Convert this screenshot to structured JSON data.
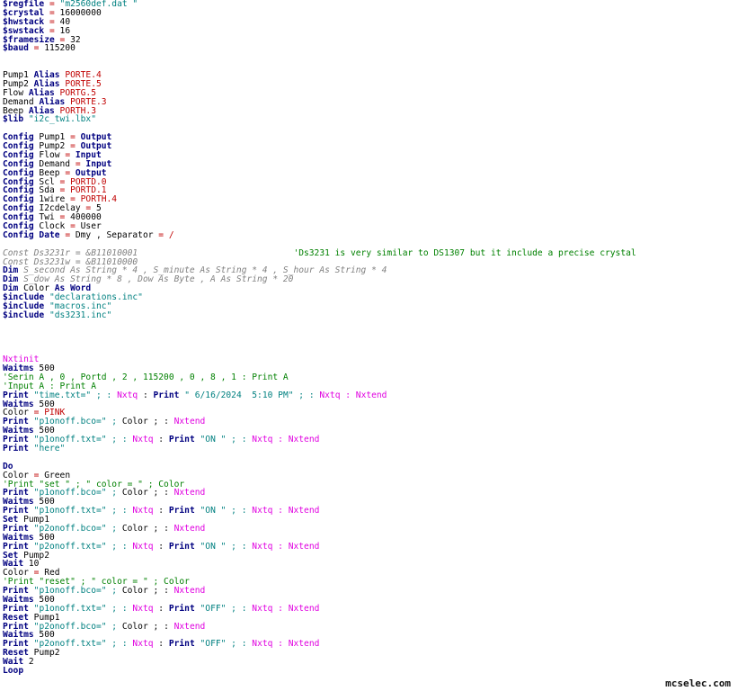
{
  "editor": {
    "lines": [
      {
        "row": 0,
        "t": [
          [
            "kw",
            "$regfile"
          ],
          [
            "red",
            " = "
          ],
          [
            "str",
            "\"m2560def.dat \""
          ]
        ]
      },
      {
        "row": 1,
        "t": [
          [
            "kw",
            "$crystal"
          ],
          [
            "red",
            " = "
          ],
          [
            "pl",
            "16000000"
          ]
        ]
      },
      {
        "row": 2,
        "t": [
          [
            "kw",
            "$hwstack"
          ],
          [
            "red",
            " = "
          ],
          [
            "pl",
            "40"
          ]
        ]
      },
      {
        "row": 3,
        "t": [
          [
            "kw",
            "$swstack"
          ],
          [
            "red",
            " = "
          ],
          [
            "pl",
            "16"
          ]
        ]
      },
      {
        "row": 4,
        "t": [
          [
            "kw",
            "$framesize"
          ],
          [
            "red",
            " = "
          ],
          [
            "pl",
            "32"
          ]
        ]
      },
      {
        "row": 5,
        "t": [
          [
            "kw",
            "$baud"
          ],
          [
            "red",
            " = "
          ],
          [
            "pl",
            "115200"
          ]
        ]
      },
      {
        "row": 8,
        "t": [
          [
            "pl",
            "Pump1 "
          ],
          [
            "kw",
            "Alias"
          ],
          [
            "red",
            " PORTE.4"
          ]
        ]
      },
      {
        "row": 9,
        "t": [
          [
            "pl",
            "Pump2 "
          ],
          [
            "kw",
            "Alias"
          ],
          [
            "red",
            " PORTE.5"
          ]
        ]
      },
      {
        "row": 10,
        "t": [
          [
            "pl",
            "Flow "
          ],
          [
            "kw",
            "Alias"
          ],
          [
            "red",
            " PORTG.5"
          ]
        ]
      },
      {
        "row": 11,
        "t": [
          [
            "pl",
            "Demand "
          ],
          [
            "kw",
            "Alias"
          ],
          [
            "red",
            " PORTE.3"
          ]
        ]
      },
      {
        "row": 12,
        "t": [
          [
            "pl",
            "Beep "
          ],
          [
            "kw",
            "Alias"
          ],
          [
            "red",
            " PORTH.3"
          ]
        ]
      },
      {
        "row": 13,
        "t": [
          [
            "kw",
            "$lib"
          ],
          [
            "str",
            " \"i2c_twi.lbx\""
          ]
        ]
      },
      {
        "row": 15,
        "t": [
          [
            "kw",
            "Config"
          ],
          [
            "pl",
            " Pump1 "
          ],
          [
            "red",
            "="
          ],
          [
            "kw",
            " Output"
          ]
        ]
      },
      {
        "row": 16,
        "t": [
          [
            "kw",
            "Config"
          ],
          [
            "pl",
            " Pump2 "
          ],
          [
            "red",
            "="
          ],
          [
            "kw",
            " Output"
          ]
        ]
      },
      {
        "row": 17,
        "t": [
          [
            "kw",
            "Config"
          ],
          [
            "pl",
            " Flow "
          ],
          [
            "red",
            "="
          ],
          [
            "kw",
            " Input"
          ]
        ]
      },
      {
        "row": 18,
        "t": [
          [
            "kw",
            "Config"
          ],
          [
            "pl",
            " Demand "
          ],
          [
            "red",
            "="
          ],
          [
            "kw",
            " Input"
          ]
        ]
      },
      {
        "row": 19,
        "t": [
          [
            "kw",
            "Config"
          ],
          [
            "pl",
            " Beep "
          ],
          [
            "red",
            "="
          ],
          [
            "kw",
            " Output"
          ]
        ]
      },
      {
        "row": 20,
        "t": [
          [
            "kw",
            "Config"
          ],
          [
            "pl",
            " Scl "
          ],
          [
            "red",
            "= PORTD.0"
          ]
        ]
      },
      {
        "row": 21,
        "t": [
          [
            "kw",
            "Config"
          ],
          [
            "pl",
            " Sda "
          ],
          [
            "red",
            "= PORTD.1"
          ]
        ]
      },
      {
        "row": 22,
        "t": [
          [
            "kw",
            "Config"
          ],
          [
            "pl",
            " 1wire "
          ],
          [
            "red",
            "= PORTH.4"
          ]
        ]
      },
      {
        "row": 23,
        "t": [
          [
            "kw",
            "Config"
          ],
          [
            "pl",
            " I2cdelay "
          ],
          [
            "red",
            "="
          ],
          [
            "pl",
            " 5"
          ]
        ]
      },
      {
        "row": 24,
        "t": [
          [
            "kw",
            "Config"
          ],
          [
            "pl",
            " Twi "
          ],
          [
            "red",
            "="
          ],
          [
            "pl",
            " 400000"
          ]
        ]
      },
      {
        "row": 25,
        "t": [
          [
            "kw",
            "Config"
          ],
          [
            "pl",
            " Clock "
          ],
          [
            "red",
            "="
          ],
          [
            "pl",
            " User"
          ]
        ]
      },
      {
        "row": 26,
        "t": [
          [
            "kw",
            "Config Date"
          ],
          [
            "red",
            " = "
          ],
          [
            "pl",
            "Dmy , Separator "
          ],
          [
            "red",
            "= /"
          ]
        ]
      },
      {
        "row": 28,
        "t": [
          [
            "ita",
            "Const Ds3231r = &B11010001                              "
          ],
          [
            "cmt",
            "'Ds3231 is very similar to DS1307 but it include a precise crystal"
          ]
        ]
      },
      {
        "row": 29,
        "t": [
          [
            "ita",
            "Const Ds3231w = &B11010000"
          ]
        ]
      },
      {
        "row": 30,
        "t": [
          [
            "kw",
            "Dim"
          ],
          [
            "ita",
            " S_second As String * 4 , S_minute As String * 4 , S_hour As String * 4"
          ]
        ]
      },
      {
        "row": 31,
        "t": [
          [
            "kw",
            "Dim"
          ],
          [
            "ita",
            " S_dow As String * 8 , Dow As Byte , A As String * 20"
          ]
        ]
      },
      {
        "row": 32,
        "t": [
          [
            "kw",
            "Dim"
          ],
          [
            "pl",
            " Color "
          ],
          [
            "kw",
            "As Word"
          ]
        ]
      },
      {
        "row": 33,
        "t": [
          [
            "kw",
            "$include"
          ],
          [
            "str",
            " \"declarations.inc\""
          ]
        ]
      },
      {
        "row": 34,
        "t": [
          [
            "kw",
            "$include"
          ],
          [
            "str",
            " \"macros.inc\""
          ]
        ]
      },
      {
        "row": 35,
        "t": [
          [
            "kw",
            "$include"
          ],
          [
            "str",
            " \"ds3231.inc\""
          ]
        ]
      },
      {
        "row": 40,
        "t": [
          [
            "mag",
            "Nxtinit"
          ]
        ]
      },
      {
        "row": 41,
        "t": [
          [
            "kw",
            "Waitms"
          ],
          [
            "pl",
            " 500"
          ]
        ]
      },
      {
        "row": 42,
        "t": [
          [
            "cmt",
            "'Serin A , 0 , Portd , 2 , 115200 , 0 , 8 , 1 : Print A"
          ]
        ]
      },
      {
        "row": 43,
        "t": [
          [
            "cmt",
            "'Input A : Print A"
          ]
        ]
      },
      {
        "row": 44,
        "t": [
          [
            "kw",
            "Print"
          ],
          [
            "str",
            " \"time.txt=\" ; : "
          ],
          [
            "mag",
            "Nxtq"
          ],
          [
            "pl",
            " : "
          ],
          [
            "kw",
            "Print"
          ],
          [
            "str",
            " \" 6/16/2024  5:10 PM\" ; : "
          ],
          [
            "mag",
            "Nxtq : Nxtend"
          ]
        ]
      },
      {
        "row": 45,
        "t": [
          [
            "kw",
            "Waitms"
          ],
          [
            "pl",
            " 500"
          ]
        ]
      },
      {
        "row": 46,
        "t": [
          [
            "pl",
            "Color "
          ],
          [
            "red",
            "= PINK"
          ]
        ]
      },
      {
        "row": 47,
        "t": [
          [
            "kw",
            "Print"
          ],
          [
            "str",
            " \"p1onoff.bco=\" ; "
          ],
          [
            "pl",
            "Color ; : "
          ],
          [
            "mag",
            "Nxtend"
          ]
        ]
      },
      {
        "row": 48,
        "t": [
          [
            "kw",
            "Waitms"
          ],
          [
            "pl",
            " 500"
          ]
        ]
      },
      {
        "row": 49,
        "t": [
          [
            "kw",
            "Print"
          ],
          [
            "str",
            " \"p1onoff.txt=\" ; : "
          ],
          [
            "mag",
            "Nxtq"
          ],
          [
            "pl",
            " : "
          ],
          [
            "kw",
            "Print"
          ],
          [
            "str",
            " \"ON \" ; : "
          ],
          [
            "mag",
            "Nxtq : Nxtend"
          ]
        ]
      },
      {
        "row": 50,
        "t": [
          [
            "kw",
            "Print"
          ],
          [
            "str",
            " \"here\""
          ]
        ]
      },
      {
        "row": 52,
        "t": [
          [
            "kw",
            "Do"
          ]
        ]
      },
      {
        "row": 53,
        "t": [
          [
            "pl",
            "Color "
          ],
          [
            "red",
            "="
          ],
          [
            "pl",
            " Green"
          ]
        ]
      },
      {
        "row": 54,
        "t": [
          [
            "cmt",
            "'Print \"set \" ; \" color = \" ; Color"
          ]
        ]
      },
      {
        "row": 55,
        "t": [
          [
            "kw",
            "Print"
          ],
          [
            "str",
            " \"p1onoff.bco=\" ; "
          ],
          [
            "pl",
            "Color ; : "
          ],
          [
            "mag",
            "Nxtend"
          ]
        ]
      },
      {
        "row": 56,
        "t": [
          [
            "kw",
            "Waitms"
          ],
          [
            "pl",
            " 500"
          ]
        ]
      },
      {
        "row": 57,
        "t": [
          [
            "kw",
            "Print"
          ],
          [
            "str",
            " \"p1onoff.txt=\" ; : "
          ],
          [
            "mag",
            "Nxtq"
          ],
          [
            "pl",
            " : "
          ],
          [
            "kw",
            "Print"
          ],
          [
            "str",
            " \"ON \" ; : "
          ],
          [
            "mag",
            "Nxtq : Nxtend"
          ]
        ]
      },
      {
        "row": 58,
        "t": [
          [
            "kw",
            "Set"
          ],
          [
            "pl",
            " Pump1"
          ]
        ]
      },
      {
        "row": 59,
        "t": [
          [
            "kw",
            "Print"
          ],
          [
            "str",
            " \"p2onoff.bco=\" ; "
          ],
          [
            "pl",
            "Color ; : "
          ],
          [
            "mag",
            "Nxtend"
          ]
        ]
      },
      {
        "row": 60,
        "t": [
          [
            "kw",
            "Waitms"
          ],
          [
            "pl",
            " 500"
          ]
        ]
      },
      {
        "row": 61,
        "t": [
          [
            "kw",
            "Print"
          ],
          [
            "str",
            " \"p2onoff.txt=\" ; : "
          ],
          [
            "mag",
            "Nxtq"
          ],
          [
            "pl",
            " : "
          ],
          [
            "kw",
            "Print"
          ],
          [
            "str",
            " \"ON \" ; : "
          ],
          [
            "mag",
            "Nxtq : Nxtend"
          ]
        ]
      },
      {
        "row": 62,
        "t": [
          [
            "kw",
            "Set"
          ],
          [
            "pl",
            " Pump2"
          ]
        ]
      },
      {
        "row": 63,
        "t": [
          [
            "kw",
            "Wait"
          ],
          [
            "pl",
            " 10"
          ]
        ]
      },
      {
        "row": 64,
        "t": [
          [
            "pl",
            "Color "
          ],
          [
            "red",
            "="
          ],
          [
            "pl",
            " Red"
          ]
        ]
      },
      {
        "row": 65,
        "t": [
          [
            "cmt",
            "'Print \"reset\" ; \" color = \" ; Color"
          ]
        ]
      },
      {
        "row": 66,
        "t": [
          [
            "kw",
            "Print"
          ],
          [
            "str",
            " \"p1onoff.bco=\" ; "
          ],
          [
            "pl",
            "Color ; : "
          ],
          [
            "mag",
            "Nxtend"
          ]
        ]
      },
      {
        "row": 67,
        "t": [
          [
            "kw",
            "Waitms"
          ],
          [
            "pl",
            " 500"
          ]
        ]
      },
      {
        "row": 68,
        "t": [
          [
            "kw",
            "Print"
          ],
          [
            "str",
            " \"p1onoff.txt=\" ; : "
          ],
          [
            "mag",
            "Nxtq"
          ],
          [
            "pl",
            " : "
          ],
          [
            "kw",
            "Print"
          ],
          [
            "str",
            " \"OFF\" ; : "
          ],
          [
            "mag",
            "Nxtq : Nxtend"
          ]
        ]
      },
      {
        "row": 69,
        "t": [
          [
            "kw",
            "Reset"
          ],
          [
            "pl",
            " Pump1"
          ]
        ]
      },
      {
        "row": 70,
        "t": [
          [
            "kw",
            "Print"
          ],
          [
            "str",
            " \"p2onoff.bco=\" ; "
          ],
          [
            "pl",
            "Color ; : "
          ],
          [
            "mag",
            "Nxtend"
          ]
        ]
      },
      {
        "row": 71,
        "t": [
          [
            "kw",
            "Waitms"
          ],
          [
            "pl",
            " 500"
          ]
        ]
      },
      {
        "row": 72,
        "t": [
          [
            "kw",
            "Print"
          ],
          [
            "str",
            " \"p2onoff.txt=\" ; : "
          ],
          [
            "mag",
            "Nxtq"
          ],
          [
            "pl",
            " : "
          ],
          [
            "kw",
            "Print"
          ],
          [
            "str",
            " \"OFF\" ; : "
          ],
          [
            "mag",
            "Nxtq : Nxtend"
          ]
        ]
      },
      {
        "row": 73,
        "t": [
          [
            "kw",
            "Reset"
          ],
          [
            "pl",
            " Pump2"
          ]
        ]
      },
      {
        "row": 74,
        "t": [
          [
            "kw",
            "Wait"
          ],
          [
            "pl",
            " 2"
          ]
        ]
      },
      {
        "row": 75,
        "t": [
          [
            "kw",
            "Loop"
          ]
        ]
      }
    ]
  },
  "watermark": "mcselec.com"
}
